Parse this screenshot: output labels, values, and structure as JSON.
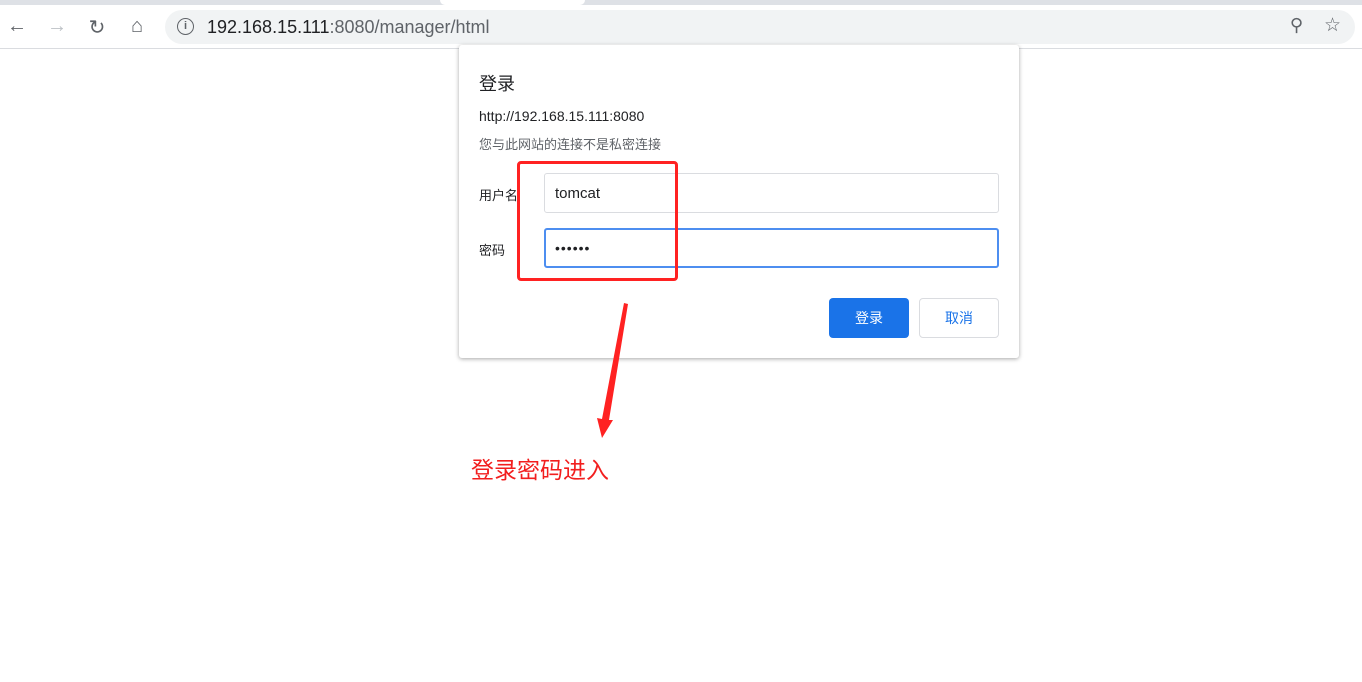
{
  "browser": {
    "url_host": "192.168.15.111",
    "url_rest": ":8080/manager/html",
    "icons": [
      "back-icon",
      "forward-icon",
      "reload-icon",
      "home-icon",
      "info-icon",
      "zoom-icon",
      "star-icon"
    ]
  },
  "dialog": {
    "title": "登录",
    "origin": "http://192.168.15.111:8080",
    "warning": "您与此网站的连接不是私密连接",
    "username_label": "用户名",
    "username_value": "tomcat",
    "password_label": "密码",
    "password_value": "••••••",
    "login_label": "登录",
    "cancel_label": "取消",
    "accent": "#1a73e8"
  },
  "annotation": {
    "text": "登录密码进入",
    "color": "#f21e1e"
  }
}
